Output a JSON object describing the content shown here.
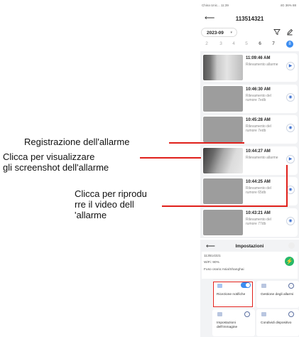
{
  "statusbar": {
    "left": "China Unic... 11:39",
    "right": "4G 36% 88"
  },
  "header": {
    "back_icon": "arrow-left-icon",
    "title": "113514321"
  },
  "date_picker": {
    "label": "2023-09",
    "caret": "▾"
  },
  "days": [
    "2",
    "3",
    "4",
    "5",
    "6",
    "7",
    "8"
  ],
  "selected_day": "8",
  "records": [
    {
      "time": "11:09:46 AM",
      "desc": "Rilevamento allarme",
      "action": "▶",
      "thumb": "cam"
    },
    {
      "time": "10:46:30 AM",
      "desc": "Rilevamento del rumore 7edb",
      "action": "◉",
      "thumb": "grey"
    },
    {
      "time": "10:45:28 AM",
      "desc": "Rilevamento del rumore 7edb",
      "action": "◉",
      "thumb": "grey"
    },
    {
      "time": "10:44:27 AM",
      "desc": "Rilevamento allarme",
      "action": "▶",
      "thumb": "cam2"
    },
    {
      "time": "10:44:25 AM",
      "desc": "Rilevamento del rumore 65db",
      "action": "◉",
      "thumb": "grey"
    },
    {
      "time": "10:43:21 AM",
      "desc": "Rilevamento del rumore 77db",
      "action": "◉",
      "thumb": "grey"
    }
  ],
  "annotations": {
    "alarm_recording": "Registrazione dell'allarme",
    "screenshot_line1": "Clicca per visualizzare",
    "screenshot_line2": "gli screenshot dell'allarme",
    "video_line1": "Clicca per riprodu",
    "video_line2": "rre il video dell",
    "video_line3": "'allarme"
  },
  "settings": {
    "title": "Impostazioni",
    "device_id": "113514321",
    "wifi": "WiFi: 90%",
    "timezone": "Fuso orario:Asia/Shanghai",
    "tiles": [
      {
        "label": "Ricezione notifiche",
        "control": "toggle"
      },
      {
        "label": "Gestione degli allarmi",
        "control": "more"
      },
      {
        "label": "Impostazioni dell'immagine",
        "control": "more"
      },
      {
        "label": "Condividi dispositivo",
        "control": "more"
      }
    ],
    "more_glyph": "···"
  },
  "colors": {
    "accent": "#3b8cf0",
    "annotation_line": "#e0201b",
    "online": "#27b86a"
  }
}
